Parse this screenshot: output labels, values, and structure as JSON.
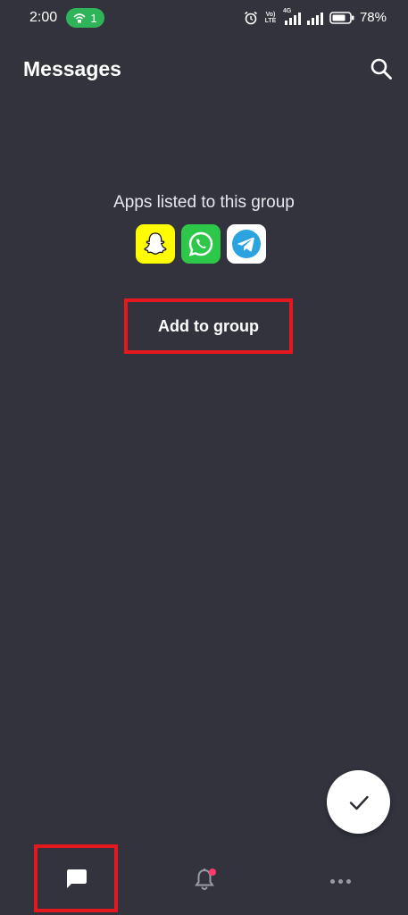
{
  "status_bar": {
    "time": "2:00",
    "hotspot_count": "1",
    "volte_label_top": "Vo)",
    "volte_label_bottom": "LTE",
    "network_type": "4G",
    "battery_percent": "78%"
  },
  "header": {
    "title": "Messages",
    "search_icon": "search-icon"
  },
  "group": {
    "apps_label": "Apps listed to this group",
    "apps": [
      {
        "name": "Snapchat",
        "icon": "snapchat-icon"
      },
      {
        "name": "WhatsApp",
        "icon": "whatsapp-icon"
      },
      {
        "name": "Telegram",
        "icon": "telegram-icon"
      }
    ],
    "add_button_label": "Add to group"
  },
  "fab": {
    "icon": "checkmark-icon"
  },
  "bottom_nav": {
    "items": [
      {
        "id": "messages",
        "icon": "chat-bubble-icon",
        "active": true
      },
      {
        "id": "notifications",
        "icon": "bell-icon",
        "has_badge": true
      },
      {
        "id": "more",
        "icon": "more-dots-icon"
      }
    ]
  },
  "colors": {
    "background": "#32333d",
    "highlight_border": "#e5181f",
    "hotspot_pill": "#2fb45a",
    "notification_dot": "#ff3a6e"
  }
}
